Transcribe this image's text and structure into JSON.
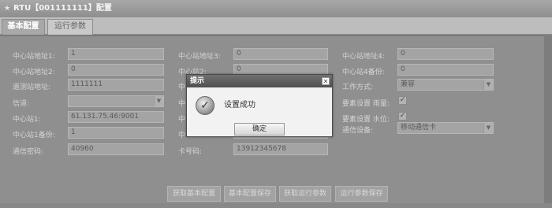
{
  "window": {
    "title": "RTU【001111111】配置"
  },
  "tabs": [
    "基本配置",
    "运行参数"
  ],
  "form": {
    "col1": [
      {
        "label": "中心站地址1:",
        "value": "1"
      },
      {
        "label": "中心站地址2:",
        "value": "0"
      },
      {
        "label": "遥测站地址:",
        "value": "1111111"
      },
      {
        "label": "信道:",
        "value": ""
      },
      {
        "label": "中心站1:",
        "value": "61.131.75.46:9001"
      },
      {
        "label": "中心站1备份:",
        "value": "1"
      },
      {
        "label": "通信密码:",
        "value": "40960"
      }
    ],
    "col2": [
      {
        "label": "中心站地址3:",
        "value": "0"
      },
      {
        "label": "中心站2:",
        "value": "0"
      },
      {
        "label": "中",
        "value": ""
      },
      {
        "label": "中",
        "value": ""
      },
      {
        "label": "中",
        "value": ""
      },
      {
        "label": "中",
        "value": ""
      },
      {
        "label": "卡号码:",
        "value": "13912345678"
      }
    ],
    "col3": {
      "addr4_label": "中心站地址4:",
      "addr4_value": "0",
      "bak4_label": "中心站4备份:",
      "bak4_value": "0",
      "mode_label": "工作方式:",
      "mode_value": "兼容",
      "rain_label": "要素设置 雨量:",
      "water_label": "要素设置 水位:",
      "device_label": "通信设备:",
      "device_value": "移动通信卡"
    }
  },
  "buttons": [
    "获取基本配置",
    "基本配置保存",
    "获取运行参数",
    "运行参数保存"
  ],
  "dialog": {
    "title": "提示",
    "message": "设置成功",
    "ok": "确定"
  }
}
